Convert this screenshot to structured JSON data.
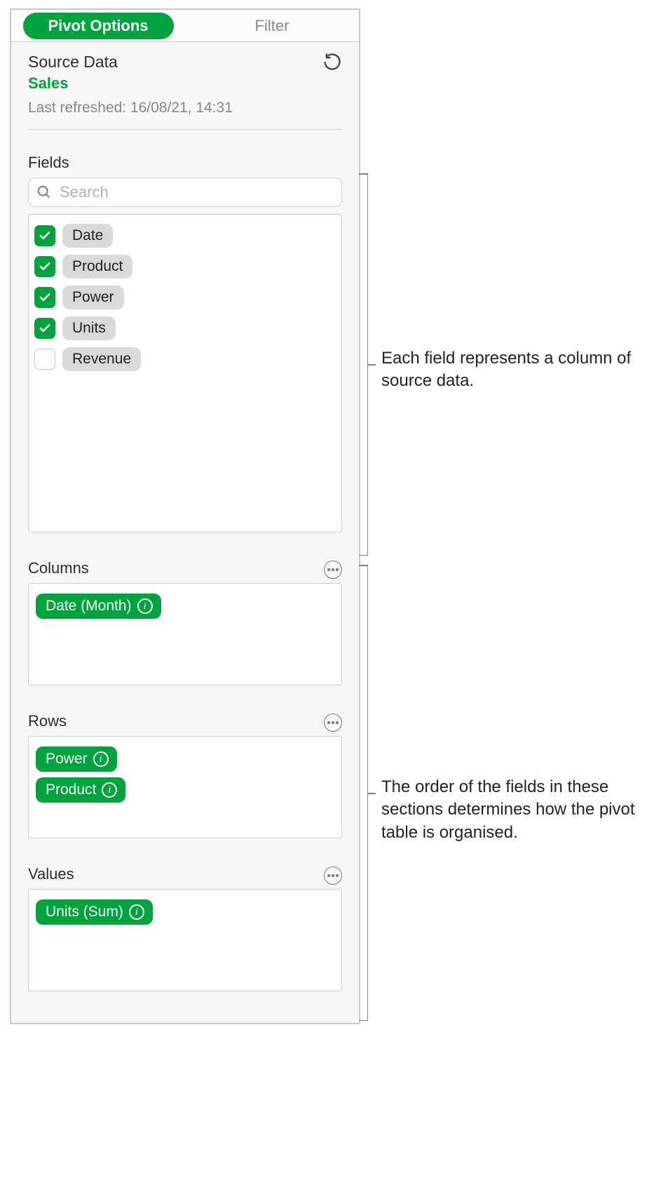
{
  "tabs": {
    "pivot_options": "Pivot Options",
    "filter": "Filter"
  },
  "source": {
    "title": "Source Data",
    "name": "Sales",
    "last_refreshed": "Last refreshed: 16/08/21, 14:31"
  },
  "fields": {
    "label": "Fields",
    "search_placeholder": "Search",
    "items": [
      {
        "label": "Date",
        "checked": true
      },
      {
        "label": "Product",
        "checked": true
      },
      {
        "label": "Power",
        "checked": true
      },
      {
        "label": "Units",
        "checked": true
      },
      {
        "label": "Revenue",
        "checked": false
      }
    ]
  },
  "zones": {
    "columns": {
      "label": "Columns",
      "chips": [
        "Date (Month)"
      ]
    },
    "rows": {
      "label": "Rows",
      "chips": [
        "Power",
        "Product"
      ]
    },
    "values": {
      "label": "Values",
      "chips": [
        "Units (Sum)"
      ]
    }
  },
  "callouts": {
    "fields": "Each field represents a column of source data.",
    "zones": "The order of the fields in these sections determines how the pivot table is organised."
  }
}
